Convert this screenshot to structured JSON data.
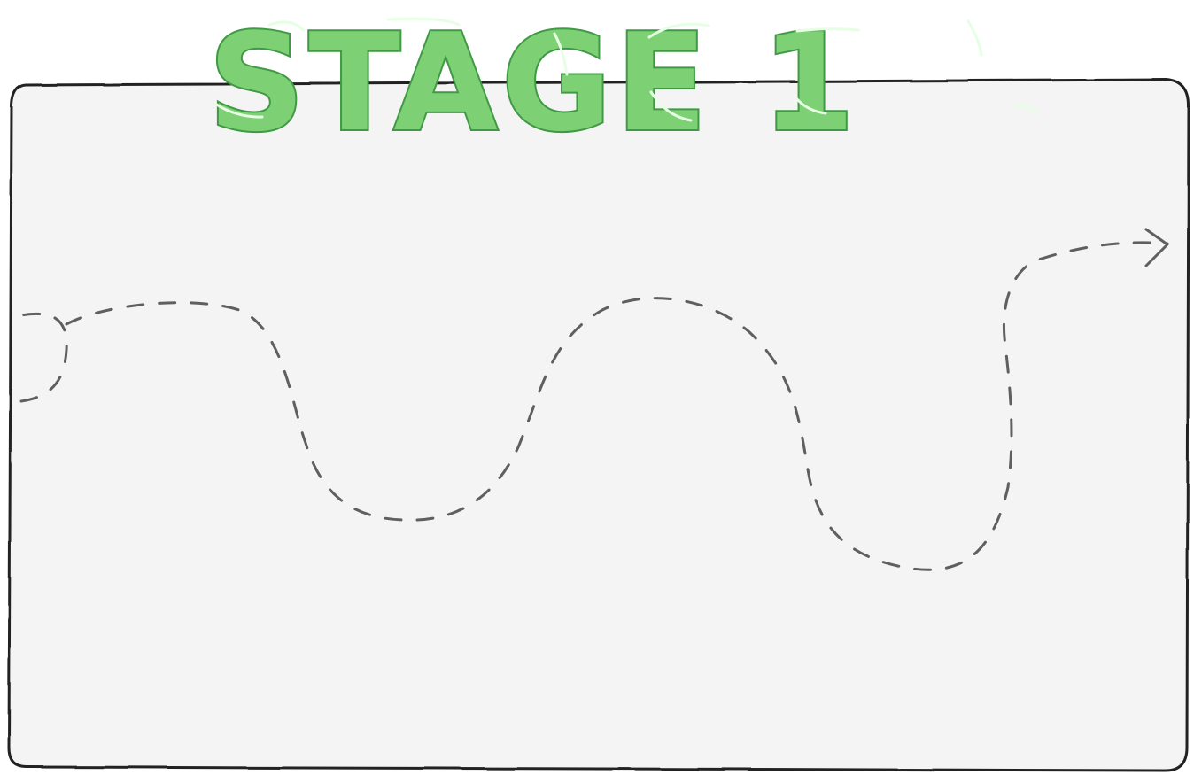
{
  "stage": {
    "title": "STAGE 1",
    "path": {
      "style": "dashed",
      "end_marker": "arrow-right-icon"
    }
  },
  "colors": {
    "background": "#ffffff",
    "board_fill": "#f4f4f4",
    "board_stroke": "#222222",
    "title_fill": "#7dd073",
    "title_stroke": "#3f9a45",
    "title_highlight": "#e6ffe4",
    "path_stroke": "#5f5f5f"
  }
}
